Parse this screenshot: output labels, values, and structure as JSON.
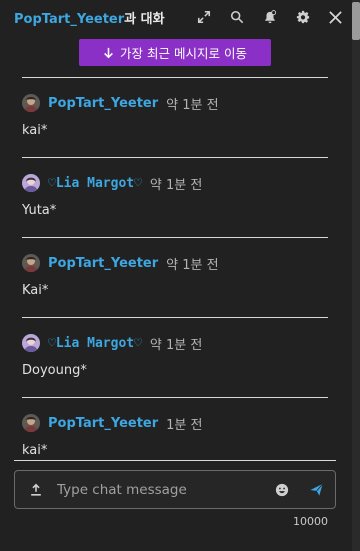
{
  "header": {
    "title_user": "PopTart_Yeeter",
    "title_suffix": "과 대화",
    "icons": [
      "expand-icon",
      "search-icon",
      "bell-icon",
      "gear-icon",
      "close-icon"
    ]
  },
  "jump_button": {
    "label": "가장 최근 메시지로 이동"
  },
  "messages": [
    {
      "author": "PopTart_Yeeter",
      "time": "약 1분 전",
      "text": "kai*",
      "avatar": "avatar-poptart"
    },
    {
      "author": "♡Lia Margot♡",
      "time": "약 1분 전",
      "text": "Yuta*",
      "avatar": "avatar-lia"
    },
    {
      "author": "PopTart_Yeeter",
      "time": "약 1분 전",
      "text": "Kai*",
      "avatar": "avatar-poptart"
    },
    {
      "author": "♡Lia Margot♡",
      "time": "약 1분 전",
      "text": "Doyoung*",
      "avatar": "avatar-lia"
    },
    {
      "author": "PopTart_Yeeter",
      "time": "1분 전",
      "text": "kai*",
      "avatar": "avatar-poptart"
    }
  ],
  "composer": {
    "placeholder": "Type chat message",
    "char_limit": "10000"
  },
  "colors": {
    "background": "#212121",
    "accent_blue": "#3ea6e0",
    "jump_purple": "#8a30c6",
    "send_blue": "#3ea6e0"
  }
}
